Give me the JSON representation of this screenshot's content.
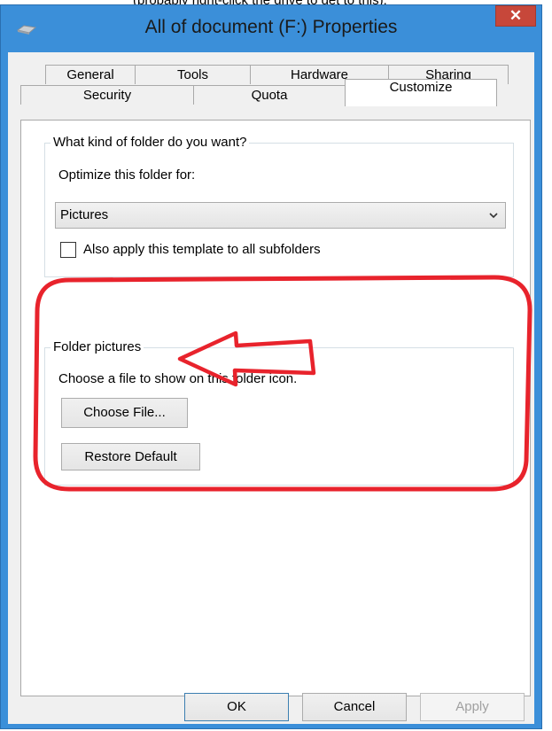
{
  "window": {
    "title": "All of document (F:) Properties",
    "close_glyph": "✕",
    "accent_color": "#3b8fd9",
    "close_color": "#c7473a"
  },
  "tabs": {
    "row_top": [
      "General",
      "Tools",
      "Hardware",
      "Sharing"
    ],
    "row_bottom": [
      "Security",
      "Quota",
      "Customize"
    ],
    "active": "Customize"
  },
  "folder_type": {
    "group_label": "What kind of folder do you want?",
    "optimize_label": "Optimize this folder for:",
    "optimize_value": "Pictures",
    "apply_subfolders_label": "Also apply this template to all subfolders",
    "apply_subfolders_checked": false
  },
  "folder_pictures": {
    "group_label": "Folder pictures",
    "description": "Choose a file to show on this folder icon.",
    "choose_file_label": "Choose File...",
    "restore_default_label": "Restore Default"
  },
  "footer": {
    "ok_label": "OK",
    "cancel_label": "Cancel",
    "apply_label": "Apply"
  },
  "annotation": {
    "color": "#e8232c",
    "highlight_icon": "rounded-rectangle-outline",
    "arrow_icon": "left-arrow-outline"
  }
}
